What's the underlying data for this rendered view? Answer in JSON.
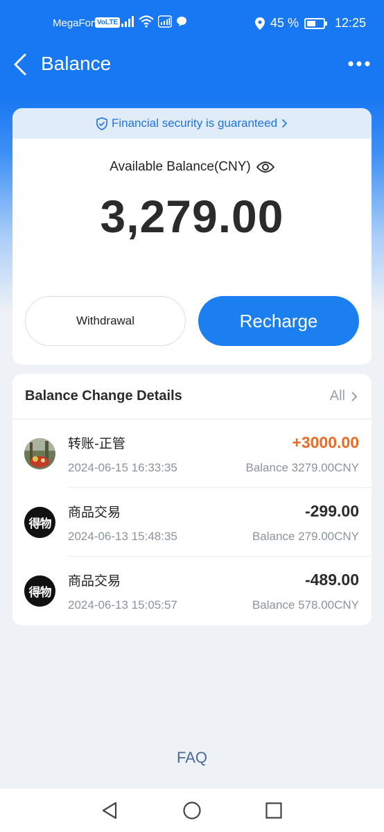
{
  "status_bar": {
    "carrier": "MegaFon",
    "volte": "VoLTE",
    "battery": "45 %",
    "time": "12:25"
  },
  "nav": {
    "title": "Balance"
  },
  "balance_card": {
    "security_text": "Financial security is guaranteed",
    "available_label": "Available Balance(CNY)",
    "amount": "3,279.00",
    "withdraw_label": "Withdrawal",
    "recharge_label": "Recharge"
  },
  "details": {
    "title": "Balance Change Details",
    "all_label": "All",
    "transactions": [
      {
        "name": "转账-正管",
        "time": "2024-06-15 16:33:35",
        "amount": "+3000.00",
        "balance": "Balance 3279.00CNY",
        "avatar": "photo-avatar"
      },
      {
        "name": "商品交易",
        "time": "2024-06-13 15:48:35",
        "amount": "-299.00",
        "balance": "Balance 279.00CNY",
        "avatar": "dewu-logo"
      },
      {
        "name": "商品交易",
        "time": "2024-06-13 15:05:57",
        "amount": "-489.00",
        "balance": "Balance 578.00CNY",
        "avatar": "dewu-logo"
      }
    ]
  },
  "dewu_logo_text": "得物",
  "faq_label": "FAQ",
  "colors": {
    "primary": "#1877f2",
    "positive_amount": "#ec6a23",
    "muted_text": "#8d939b"
  }
}
